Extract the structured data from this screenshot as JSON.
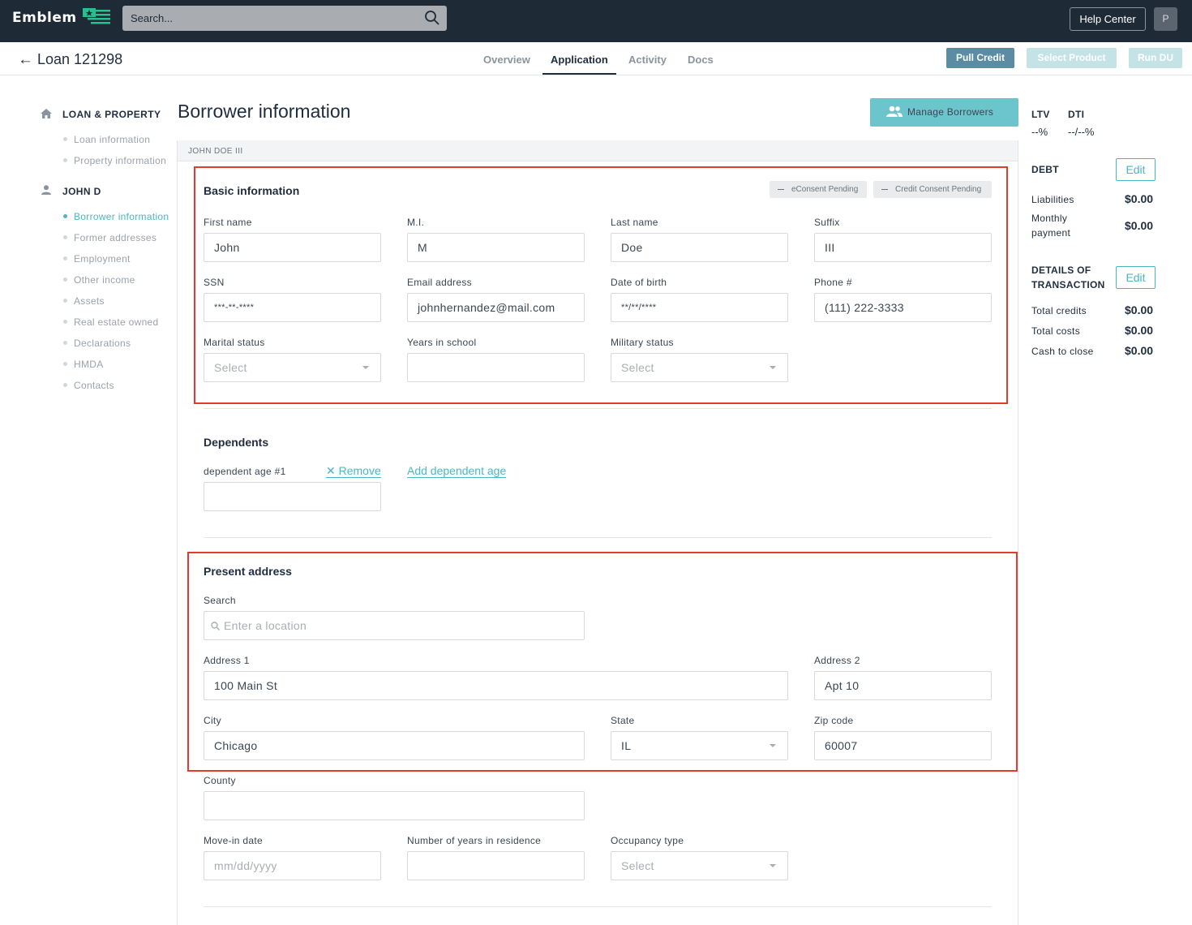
{
  "topbar": {
    "logo": "Emblem",
    "search_placeholder": "Search...",
    "help_label": "Help Center",
    "avatar_initial": "P"
  },
  "subbar": {
    "back_arrow": "←",
    "loan_title": "Loan 121298",
    "tabs": [
      "Overview",
      "Application",
      "Activity",
      "Docs"
    ],
    "active_tab": "Application",
    "buttons": {
      "pull_credit": "Pull Credit",
      "select_product": "Select Product",
      "run_du": "Run DU"
    }
  },
  "leftnav": {
    "sections": [
      {
        "title": "LOAN & PROPERTY",
        "icon": "home-icon",
        "items": [
          "Loan information",
          "Property information"
        ]
      },
      {
        "title": "JOHN D",
        "icon": "person-icon",
        "items": [
          "Borrower information",
          "Former addresses",
          "Employment",
          "Other income",
          "Assets",
          "Real estate owned",
          "Declarations",
          "HMDA",
          "Contacts"
        ]
      }
    ],
    "active_item": "Borrower information"
  },
  "main": {
    "page_title": "Borrower information",
    "manage_label": "Manage Borrowers",
    "borrower_header": "JOHN DOE III",
    "basic": {
      "title": "Basic information",
      "badges": [
        "eConsent Pending",
        "Credit Consent Pending"
      ],
      "fields": {
        "first_name": {
          "label": "First name",
          "value": "John"
        },
        "mi": {
          "label": "M.I.",
          "value": "M"
        },
        "last_name": {
          "label": "Last name",
          "value": "Doe"
        },
        "suffix": {
          "label": "Suffix",
          "value": "III"
        },
        "ssn": {
          "label": "SSN",
          "value": "***-**-****"
        },
        "email": {
          "label": "Email address",
          "value": "johnhernandez@mail.com"
        },
        "dob": {
          "label": "Date of birth",
          "value": "**/**/****"
        },
        "phone": {
          "label": "Phone #",
          "value": "(111) 222-3333"
        },
        "marital": {
          "label": "Marital status",
          "value": "Select"
        },
        "years_school": {
          "label": "Years in school",
          "value": ""
        },
        "military": {
          "label": "Military status",
          "value": "Select"
        }
      }
    },
    "dependents": {
      "title": "Dependents",
      "age_label": "dependent age #1",
      "remove_label": "Remove",
      "add_label": "Add dependent age",
      "age_value": ""
    },
    "address": {
      "title": "Present address",
      "search_label": "Search",
      "search_placeholder": "Enter a location",
      "address1": {
        "label": "Address 1",
        "value": "100 Main St"
      },
      "address2": {
        "label": "Address 2",
        "value": "Apt 10"
      },
      "city": {
        "label": "City",
        "value": "Chicago"
      },
      "state": {
        "label": "State",
        "value": "IL"
      },
      "zip": {
        "label": "Zip code",
        "value": "60007"
      },
      "county": {
        "label": "County",
        "value": ""
      },
      "move_in": {
        "label": "Move-in date",
        "placeholder": "mm/dd/yyyy"
      },
      "years_residence": {
        "label": "Number of years in residence",
        "value": ""
      },
      "occupancy": {
        "label": "Occupancy type",
        "value": "Select"
      }
    }
  },
  "sidebar": {
    "ltv_label": "LTV",
    "ltv_value": "--%",
    "dti_label": "DTI",
    "dti_value": "--/--%",
    "debt": {
      "title": "DEBT",
      "edit": "Edit",
      "liabilities_label": "Liabilities",
      "liabilities_value": "$0.00",
      "monthly_label_1": "Monthly",
      "monthly_label_2": "payment",
      "monthly_value": "$0.00"
    },
    "transaction": {
      "title_1": "DETAILS OF",
      "title_2": "TRANSACTION",
      "edit": "Edit",
      "credits_label": "Total credits",
      "credits_value": "$0.00",
      "costs_label": "Total costs",
      "costs_value": "$0.00",
      "cash_label": "Cash to close",
      "cash_value": "$0.00"
    }
  },
  "colors": {
    "topbar": "#1e2a36",
    "accent": "#4bb6bf",
    "pull_credit": "#5a8ca3",
    "disabled_button": "#c4e3e7",
    "highlight": "#e53a2f"
  }
}
